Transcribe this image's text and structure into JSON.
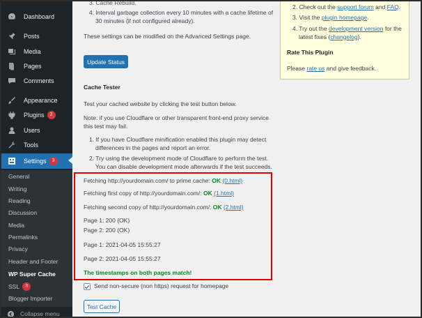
{
  "sidebar": {
    "items": [
      {
        "label": "Dashboard",
        "icon": "dashboard-icon"
      },
      {
        "label": "Posts",
        "icon": "pin-icon"
      },
      {
        "label": "Media",
        "icon": "media-icon"
      },
      {
        "label": "Pages",
        "icon": "pages-icon"
      },
      {
        "label": "Comments",
        "icon": "comment-icon"
      },
      {
        "label": "Appearance",
        "icon": "brush-icon"
      },
      {
        "label": "Plugins",
        "icon": "plugin-icon",
        "badge": "2"
      },
      {
        "label": "Users",
        "icon": "user-icon"
      },
      {
        "label": "Tools",
        "icon": "wrench-icon"
      },
      {
        "label": "Settings",
        "icon": "settings-icon",
        "badge": "3"
      }
    ],
    "submenu": [
      {
        "label": "General"
      },
      {
        "label": "Writing"
      },
      {
        "label": "Reading"
      },
      {
        "label": "Discussion"
      },
      {
        "label": "Media"
      },
      {
        "label": "Permalinks"
      },
      {
        "label": "Privacy"
      },
      {
        "label": "Header and Footer"
      },
      {
        "label": "WP Super Cache"
      },
      {
        "label": "SSL",
        "badge": "3"
      },
      {
        "label": "Blogger Importer"
      }
    ],
    "collapse_label": "Collapse menu"
  },
  "main": {
    "cut_item": "3. Cache Rebuild.",
    "item4": "4. Interval garbage collection every 10 minutes with a cache lifetime of 30 minutes (if not configured already).",
    "settings_note": "These settings can be modified on the Advanced Settings page.",
    "update_button": "Update Status",
    "cache_tester_title": "Cache Tester",
    "tester_intro": "Test your cached website by clicking the test button below.",
    "cloudflare_note": "Note: if you use Cloudflare or other transparent front-end proxy service this test may fail.",
    "note1": "1. If you have Cloudflare minification enabled this plugin may detect differences in the pages and report an error.",
    "note2": "2. Try using the development mode of Cloudflare to perform the test. You can disable development mode afterwards if the test succeeds.",
    "results": {
      "fetch1_text": "Fetching http://yourdomain.com/ to prime cache:",
      "fetch1_ok": "OK",
      "fetch1_link": "(0.html)",
      "fetch2_text": "Fetching first copy of http://yourdomain.com/:",
      "fetch2_ok": "OK",
      "fetch2_link": "(1.html)",
      "fetch3_text": "Fetching second copy of http://yourdomain.com/:",
      "fetch3_ok": "OK",
      "fetch3_link": "(2.html)",
      "page1_status": "Page 1: 200 (OK)",
      "page2_status": "Page 2: 200 (OK)",
      "page1_time": "Page 1: 2021-04-05 15:55:27",
      "page2_time": "Page 2: 2021-04-05 15:55:27",
      "match_msg": "The timestamps on both pages match!"
    },
    "checkbox_label": "Send non-secure (non https) request for homepage",
    "checkbox_checked": true,
    "test_button": "Test Cache"
  },
  "infobox": {
    "line2_pre": "2. Check out the",
    "line2_link1": "support forum",
    "line2_mid": "and",
    "line2_link2": "FAQ",
    "line2_post": ".",
    "line3_pre": "3. Visit the",
    "line3_link": "plugin homepage",
    "line3_post": ".",
    "line4_pre": "4. Try out the",
    "line4_link": "development version",
    "line4_mid": "for the latest fixes (",
    "line4_link2": "changelog",
    "line4_post": ").",
    "rate_title": "Rate This Plugin",
    "rate_pre": "Please",
    "rate_link": "rate us",
    "rate_post": "and give feedback."
  },
  "colors": {
    "sidebar_bg": "#1d2327",
    "active": "#2271b1",
    "ok": "#008a20",
    "highlight": "#e00000",
    "infobox_bg": "#ffffe0"
  }
}
